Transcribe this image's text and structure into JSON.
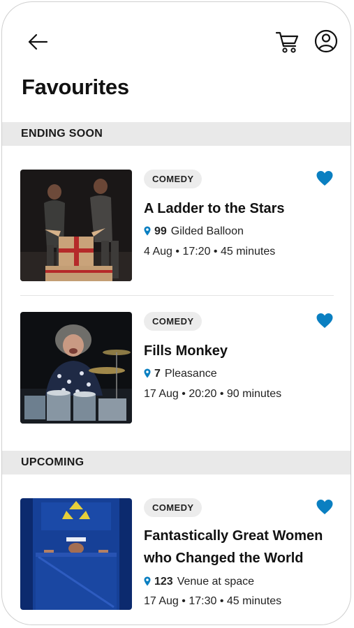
{
  "header": {
    "title": "Favourites",
    "back_icon": "arrow-left-icon",
    "cart_icon": "cart-icon",
    "account_icon": "user-circle-icon"
  },
  "colors": {
    "accent": "#0a7fc1",
    "section_bg": "#e9e9e9",
    "badge_bg": "#ececec"
  },
  "sections": [
    {
      "label": "ENDING SOON",
      "items": [
        {
          "category": "COMEDY",
          "title": "A Ladder to the Stars",
          "venue_number": "99",
          "venue_name": "Gilded Balloon",
          "date": "4 Aug",
          "time": "17:20",
          "duration": "45 minutes",
          "favourited": true
        },
        {
          "category": "COMEDY",
          "title": "Fills Monkey",
          "venue_number": "7",
          "venue_name": "Pleasance",
          "date": "17 Aug",
          "time": "20:20",
          "duration": "90 minutes",
          "favourited": true
        }
      ]
    },
    {
      "label": "UPCOMING",
      "items": [
        {
          "category": "COMEDY",
          "title": "Fantastically Great Women who Changed the World",
          "venue_number": "123",
          "venue_name": "Venue at space",
          "date": "17 Aug",
          "time": "17:30",
          "duration": "45 minutes",
          "favourited": true
        }
      ]
    }
  ]
}
